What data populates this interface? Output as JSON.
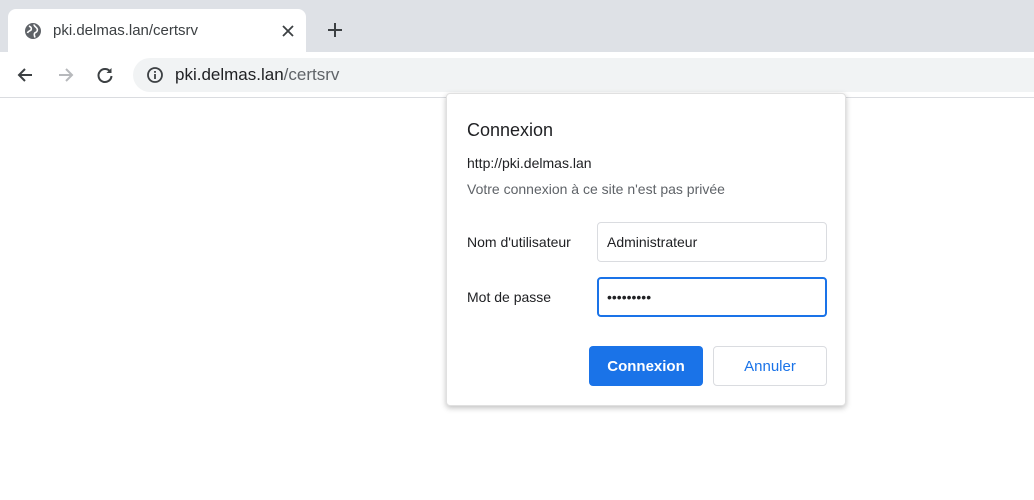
{
  "browser": {
    "tab": {
      "title": "pki.delmas.lan/certsrv",
      "favicon": "globe-icon",
      "close_icon": "close-icon"
    },
    "new_tab_icon": "plus-icon",
    "nav": {
      "back_icon": "arrow-left-icon",
      "forward_icon": "arrow-right-icon",
      "reload_icon": "reload-icon"
    },
    "omnibox": {
      "security_icon": "info-icon",
      "url_host": "pki.delmas.lan",
      "url_path": "/certsrv"
    }
  },
  "dialog": {
    "title": "Connexion",
    "origin": "http://pki.delmas.lan",
    "warning": "Votre connexion à ce site n'est pas privée",
    "username": {
      "label": "Nom d'utilisateur",
      "value": "Administrateur"
    },
    "password": {
      "label": "Mot de passe",
      "value": "•••••••••"
    },
    "buttons": {
      "sign_in": "Connexion",
      "cancel": "Annuler"
    }
  },
  "colors": {
    "accent": "#1a73e8",
    "tabstrip": "#dee1e6",
    "omnibox": "#f1f3f4"
  }
}
